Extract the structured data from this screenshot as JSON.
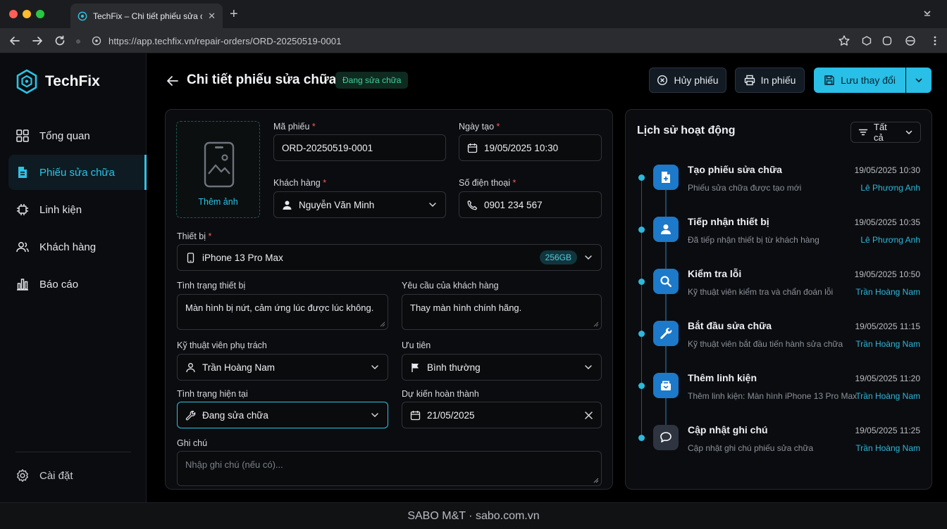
{
  "browser": {
    "tab_title": "TechFix – Chi tiết phiếu sửa chữa",
    "url": "https://app.techfix.vn/repair-orders/ORD-20250519-0001"
  },
  "sidebar": {
    "brand": "TechFix",
    "items": [
      {
        "label": "Tổng quan",
        "icon": "grid-icon"
      },
      {
        "label": "Phiếu sửa chữa",
        "icon": "document-icon",
        "active": true
      },
      {
        "label": "Linh kiện",
        "icon": "chip-icon"
      },
      {
        "label": "Khách hàng",
        "icon": "users-icon"
      },
      {
        "label": "Báo cáo",
        "icon": "bar-chart-icon"
      }
    ],
    "settings_label": "Cài đặt"
  },
  "header": {
    "title": "Chi tiết phiếu sửa chữa",
    "status": "Đang sửa chữa",
    "cancel_label": "Hủy phiếu",
    "print_label": "In phiếu",
    "save_label": "Lưu thay đổi"
  },
  "form": {
    "photo_label": "Thêm ảnh",
    "order_code": {
      "label": "Mã phiếu",
      "value": "ORD-20250519-0001"
    },
    "created_at": {
      "label": "Ngày tạo",
      "value": "19/05/2025 10:30"
    },
    "customer": {
      "label": "Khách hàng",
      "value": "Nguyễn Văn Minh"
    },
    "phone": {
      "label": "Số điện thoại",
      "value": "0901 234 567"
    },
    "device": {
      "label": "Thiết bị",
      "value": "iPhone 13 Pro Max",
      "badge": "256GB"
    },
    "condition": {
      "label": "Tình trạng thiết bị",
      "value": "Màn hình bị nứt, cảm ứng lúc được lúc không."
    },
    "request": {
      "label": "Yêu cầu của khách hàng",
      "value": "Thay màn hình chính hãng."
    },
    "technician": {
      "label": "Kỹ thuật viên phụ trách",
      "value": "Trần Hoàng Nam"
    },
    "priority": {
      "label": "Ưu tiên",
      "value": "Bình thường"
    },
    "current_status": {
      "label": "Tình trạng hiện tại",
      "value": "Đang sửa chữa"
    },
    "due": {
      "label": "Dự kiến hoàn thành",
      "value": "21/05/2025"
    },
    "note": {
      "label": "Ghi chú",
      "placeholder": "Nhập ghi chú (nếu có)..."
    }
  },
  "activity": {
    "title": "Lịch sử hoạt động",
    "filter": "Tất cả",
    "events": [
      {
        "title": "Tạo phiếu sửa chữa",
        "desc": "Phiếu sửa chữa được tạo mới",
        "time": "19/05/2025 10:30",
        "user": "Lê Phương Anh",
        "icon": "document-plus-icon"
      },
      {
        "title": "Tiếp nhận thiết bị",
        "desc": "Đã tiếp nhận thiết bị từ khách hàng",
        "time": "19/05/2025 10:35",
        "user": "Lê Phương Anh",
        "icon": "user-icon"
      },
      {
        "title": "Kiểm tra lỗi",
        "desc": "Kỹ thuật viên kiểm tra và chẩn đoán lỗi",
        "time": "19/05/2025 10:50",
        "user": "Trần Hoàng Nam",
        "icon": "search-icon"
      },
      {
        "title": "Bắt đầu sửa chữa",
        "desc": "Kỹ thuật viên bắt đầu tiến hành sửa chữa",
        "time": "19/05/2025 11:15",
        "user": "Trần Hoàng Nam",
        "icon": "wrench-icon"
      },
      {
        "title": "Thêm linh kiện",
        "desc": "Thêm linh kiện: Màn hình iPhone 13 Pro Max",
        "time": "19/05/2025 11:20",
        "user": "Trần Hoàng Nam",
        "icon": "package-icon"
      },
      {
        "title": "Cập nhật ghi chú",
        "desc": "Cập nhật ghi chú phiếu sửa chữa",
        "time": "19/05/2025 11:25",
        "user": "Trần Hoàng Nam",
        "icon": "chat-icon"
      }
    ]
  },
  "footer": {
    "text": "SABO M&T · sabo.com.vn"
  },
  "colors": {
    "accent": "#29bfe6",
    "success": "#3fd39a",
    "required": "#f25b5b"
  }
}
